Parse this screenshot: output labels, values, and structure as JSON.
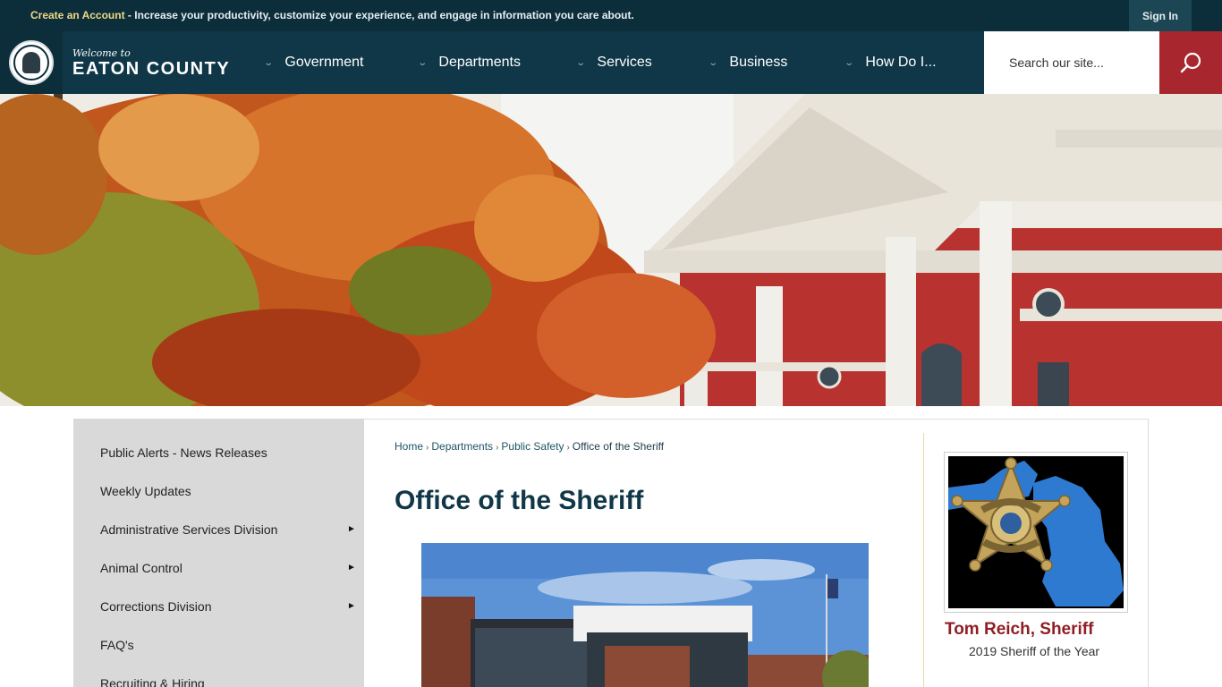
{
  "topbar": {
    "create_account": "Create an Account",
    "promo_text": " - Increase your productivity, customize your experience, and engage in information you care about.",
    "sign_in": "Sign In"
  },
  "brand": {
    "welcome": "Welcome to",
    "county": "EATON COUNTY"
  },
  "nav": {
    "items": [
      {
        "label": "Government"
      },
      {
        "label": "Departments"
      },
      {
        "label": "Services"
      },
      {
        "label": "Business"
      },
      {
        "label": "How Do I..."
      }
    ],
    "search_placeholder": "Search our site..."
  },
  "sidebar": {
    "items": [
      {
        "label": "Public Alerts - News Releases"
      },
      {
        "label": "Weekly Updates"
      },
      {
        "label": "Administrative Services Division"
      },
      {
        "label": "Animal Control"
      },
      {
        "label": "Corrections Division"
      },
      {
        "label": "FAQ's"
      },
      {
        "label": "Recruiting & Hiring"
      }
    ],
    "arrow_glyph": "►"
  },
  "breadcrumb": {
    "home": "Home",
    "departments": "Departments",
    "public_safety": "Public Safety",
    "current": "Office of the Sheriff",
    "separator": "›"
  },
  "main": {
    "title": "Office of the Sheriff"
  },
  "aside": {
    "name": "Tom Reich, Sheriff",
    "subtitle": "2019 Sheriff of the Year"
  },
  "colors": {
    "topbar": "#0c2e3b",
    "navbar": "#103747",
    "accent_red": "#a8272e",
    "create_gold": "#f2d784",
    "title_navy": "#103747",
    "sheriff_red": "#8f1f25"
  }
}
